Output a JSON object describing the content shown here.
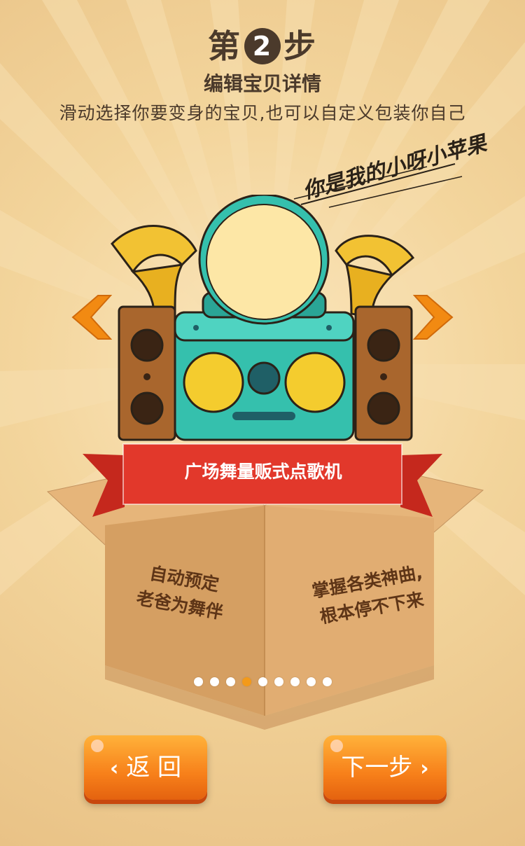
{
  "header": {
    "step_prefix": "第",
    "step_number": "2",
    "step_suffix": "步",
    "subtitle": "编辑宝贝详情",
    "description": "滑动选择你要变身的宝贝,也可以自定义包装你自己"
  },
  "tagline": "你是我的小呀小苹果",
  "product": {
    "name": "广场舞量贩式点歌机",
    "feature_left_line1": "自动预定",
    "feature_left_line2": "老爸为舞伴",
    "feature_right_line1": "掌握各类神曲,",
    "feature_right_line2": "根本停不下来"
  },
  "carousel": {
    "total": 9,
    "active_index": 3
  },
  "buttons": {
    "back_label": "返 回",
    "next_label": "下一步",
    "back_chevron": "‹",
    "next_chevron": "›"
  },
  "colors": {
    "accent_orange": "#f39a1a",
    "ribbon_red": "#e03a2c",
    "box_brown": "#d8a36a",
    "speaker_teal": "#35c0ad",
    "text_dark": "#4b3a2b"
  }
}
